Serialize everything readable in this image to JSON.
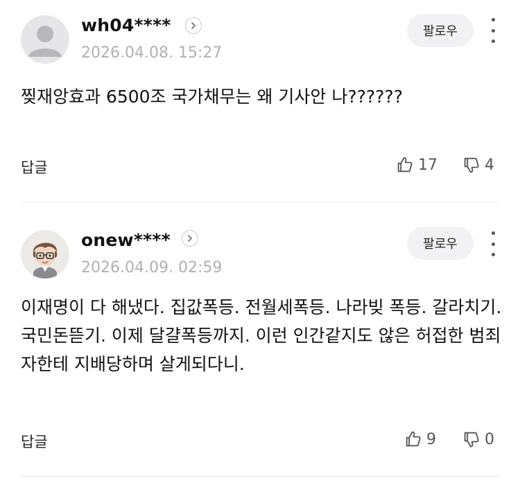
{
  "comments": [
    {
      "username": "wh04****",
      "timestamp": "2026.04.08. 15:27",
      "follow_label": "팔로우",
      "body": "찢재앙효과 6500조 국가채무는 왜 기사안 나??????",
      "reply_label": "답글",
      "likes": "17",
      "dislikes": "4",
      "avatar": "default-person-icon"
    },
    {
      "username": "onew****",
      "timestamp": "2026.04.09. 02:59",
      "follow_label": "팔로우",
      "body": "이재명이 다 해냈다. 집값폭등. 전월세폭등. 나라빚 폭등. 갈라치기. 국민돈뜯기. 이제 달걀폭등까지. 이런 인간같지도 않은 허접한 범죄자한테 지배당하며 살게되다니.",
      "reply_label": "답글",
      "likes": "9",
      "dislikes": "0",
      "avatar": "cartoon-character-avatar"
    }
  ],
  "colors": {
    "text": "#111111",
    "muted": "#b0b0b0",
    "button_bg": "#f2f2f4",
    "divider": "#e6e6e6"
  }
}
